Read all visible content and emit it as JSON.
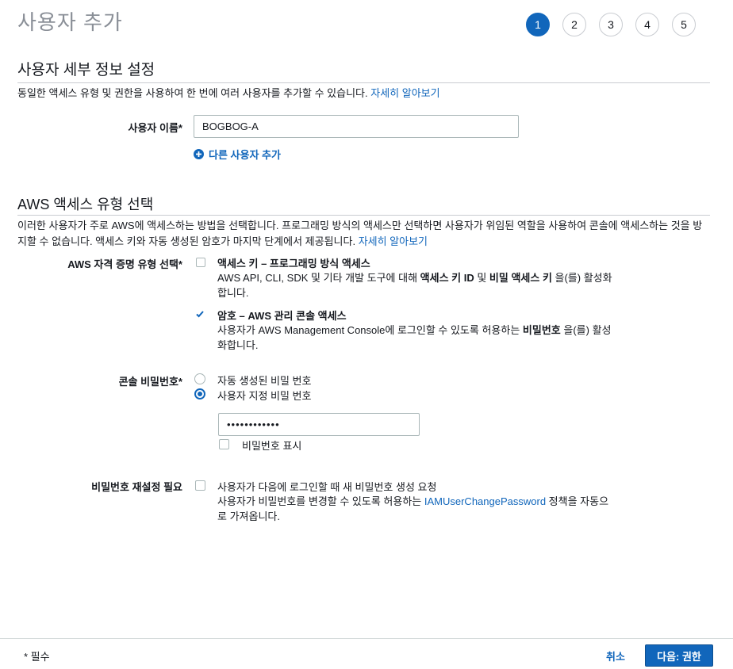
{
  "page": {
    "title": "사용자 추가"
  },
  "steps": [
    "1",
    "2",
    "3",
    "4",
    "5"
  ],
  "details": {
    "title": "사용자 세부 정보 설정",
    "desc": "동일한 액세스 유형 및 권한을 사용하여 한 번에 여러 사용자를 추가할 수 있습니다.",
    "desc_link": "자세히 알아보기",
    "username_label": "사용자 이름*",
    "username_value": "BOGBOG-A",
    "add_user_link": "다른 사용자 추가"
  },
  "access": {
    "title": "AWS 액세스 유형 선택",
    "desc": "이러한 사용자가 주로 AWS에 액세스하는 방법을 선택합니다. 프로그래밍 방식의 액세스만 선택하면 사용자가 위임된 역할을 사용하여 콘솔에 액세스하는 것을 방지할 수 없습니다. 액세스 키와 자동 생성된 암호가 마지막 단계에서 제공됩니다.",
    "desc_link": "자세히 알아보기",
    "cred_label": "AWS 자격 증명 유형 선택*",
    "opt1_title": "액세스 키 – 프로그래밍 방식 액세스",
    "opt1_desc_a": "AWS API, CLI, SDK 및 기타 개발 도구에 대해 ",
    "opt1_desc_b1": "액세스 키 ID",
    "opt1_desc_c": " 및 ",
    "opt1_desc_b2": "비밀 액세스 키",
    "opt1_desc_d": " 을(를) 활성화합니다.",
    "opt1_checked": false,
    "opt2_title": "암호 – AWS 관리 콘솔 액세스",
    "opt2_desc_a": "사용자가 AWS Management Console에 로그인할 수 있도록 허용하는 ",
    "opt2_desc_b": "비밀번호",
    "opt2_desc_c": " 을(를) 활성화합니다.",
    "opt2_checked": true
  },
  "console_password": {
    "label": "콘솔 비밀번호*",
    "radio_auto": "자동 생성된 비밀 번호",
    "radio_custom": "사용자 지정 비밀 번호",
    "selected": "custom",
    "password_value": "••••••••••••",
    "show_password": "비밀번호 표시"
  },
  "reset": {
    "label": "비밀번호 재설정 필요",
    "title": "사용자가 다음에 로그인할 때 새 비밀번호 생성 요청",
    "desc_a": "사용자가 비밀번호를 변경할 수 있도록 허용하는 ",
    "desc_link": "IAMUserChangePassword",
    "desc_b": " 정책을 자동으로 가져옵니다."
  },
  "footer": {
    "required": "* 필수",
    "cancel": "취소",
    "next": "다음: 권한"
  },
  "colors": {
    "accent": "#1166bb",
    "title_gray": "#8a8f97"
  }
}
